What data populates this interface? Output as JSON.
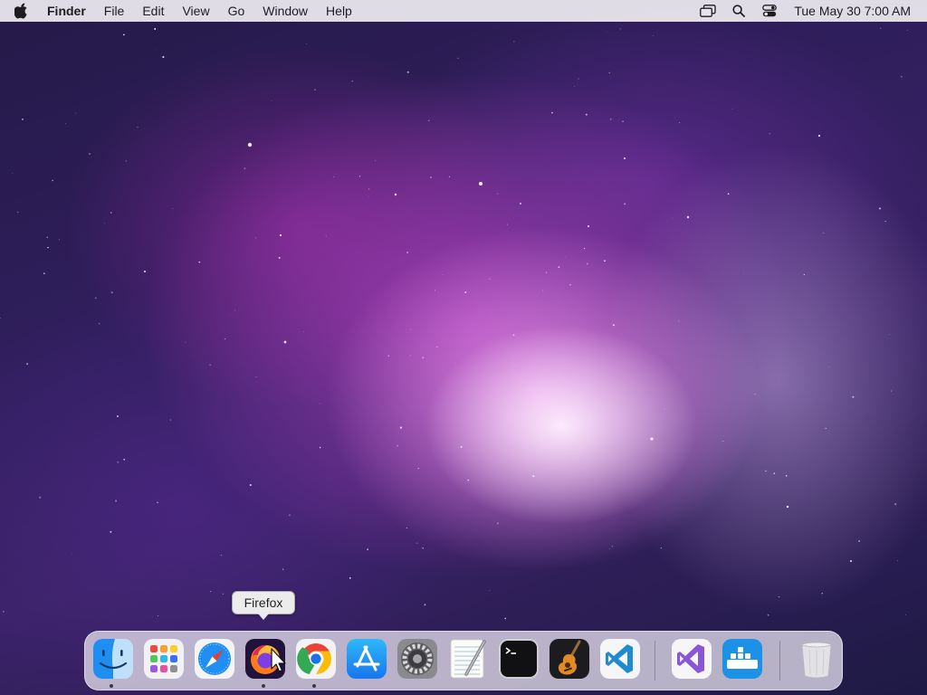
{
  "menubar": {
    "apple_icon": "apple-logo-icon",
    "app_name": "Finder",
    "menus": [
      "File",
      "Edit",
      "View",
      "Go",
      "Window",
      "Help"
    ],
    "status_icons": [
      "screen-mirroring-icon",
      "spotlight-search-icon",
      "control-center-icon"
    ],
    "clock": "Tue May 30  7:00 AM"
  },
  "tooltip": {
    "text": "Firefox"
  },
  "dock": {
    "apps": [
      {
        "name": "Finder",
        "icon": "finder-icon",
        "running": true
      },
      {
        "name": "Launchpad",
        "icon": "launchpad-icon",
        "running": false
      },
      {
        "name": "Safari",
        "icon": "safari-icon",
        "running": false
      },
      {
        "name": "Firefox",
        "icon": "firefox-icon",
        "running": true
      },
      {
        "name": "Google Chrome",
        "icon": "chrome-icon",
        "running": true
      },
      {
        "name": "App Store",
        "icon": "app-store-icon",
        "running": false
      },
      {
        "name": "System Preferences",
        "icon": "system-preferences-icon",
        "running": false
      },
      {
        "name": "TextEdit",
        "icon": "textedit-icon",
        "running": false
      },
      {
        "name": "Terminal",
        "icon": "terminal-icon",
        "running": false
      },
      {
        "name": "GarageBand",
        "icon": "garageband-icon",
        "running": false
      },
      {
        "name": "Visual Studio Code",
        "icon": "vscode-icon",
        "running": false
      },
      {
        "name": "Visual Studio",
        "icon": "visual-studio-icon",
        "running": false
      },
      {
        "name": "Docker",
        "icon": "docker-icon",
        "running": false
      },
      {
        "name": "Trash",
        "icon": "trash-icon",
        "running": false
      }
    ]
  }
}
